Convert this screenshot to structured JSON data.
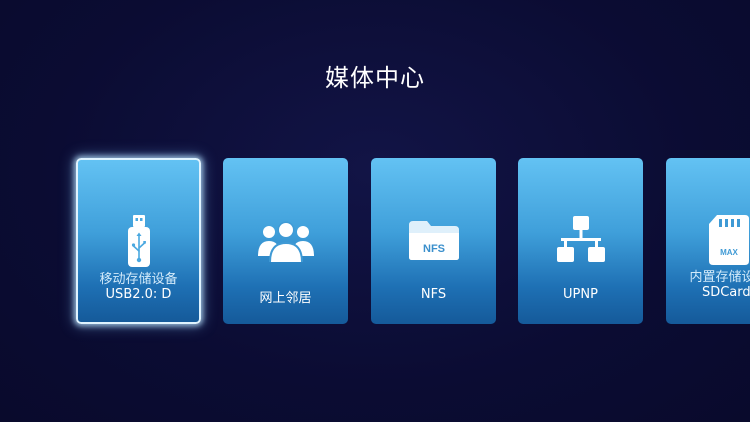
{
  "page": {
    "title": "媒体中心"
  },
  "cards": [
    {
      "line1": "移动存储设备",
      "line2": "USB2.0: D",
      "icon": "usb-drive-icon"
    },
    {
      "label": "网上邻居",
      "icon": "people-group-icon"
    },
    {
      "label": "NFS",
      "icon": "nfs-folder-icon",
      "icon_text": "NFS"
    },
    {
      "label": "UPNP",
      "icon": "network-topology-icon"
    },
    {
      "line1": "内置存储设备",
      "line2": "SDCard: ",
      "icon": "sd-card-icon",
      "icon_text": "MAX"
    }
  ],
  "colors": {
    "background": "#0c0d35",
    "card_top": "#63c2f3",
    "card_bottom": "#155a9a",
    "focus_border": "#dff3ff"
  }
}
